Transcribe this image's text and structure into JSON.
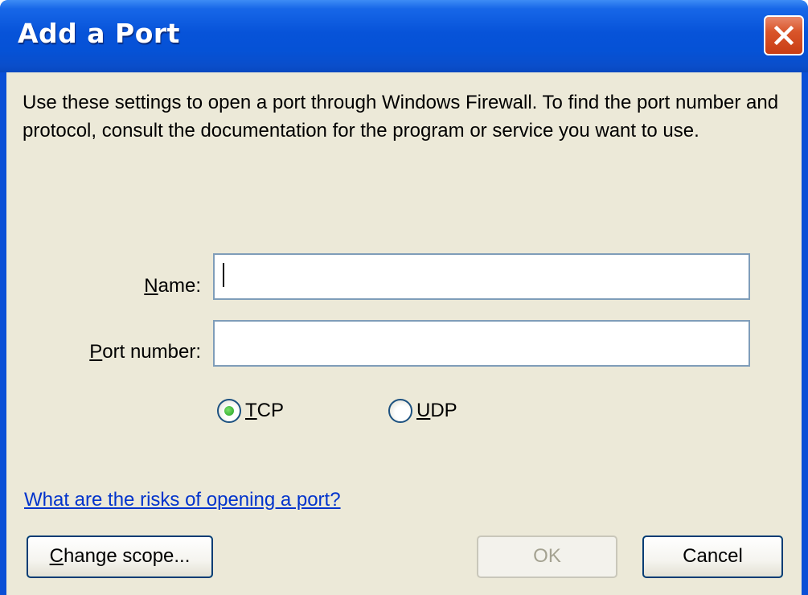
{
  "window": {
    "title": "Add a Port",
    "close_icon": "close-x-icon"
  },
  "dialog": {
    "description": "Use these settings to open a port through Windows Firewall. To find the port number and protocol, consult the documentation for the program or service you want to use.",
    "name_label_accel": "N",
    "name_label_rest": "ame:",
    "name_value": "",
    "port_label_accel": "P",
    "port_label_rest": "ort number:",
    "port_value": "",
    "tcp_label_accel": "T",
    "tcp_label_rest": "CP",
    "tcp_selected": true,
    "udp_label_accel": "U",
    "udp_label_rest": "DP",
    "udp_selected": false,
    "risk_link": "What are the risks of opening a port?",
    "change_scope_accel": "C",
    "change_scope_rest": "hange scope...",
    "ok_label": "OK",
    "ok_enabled": false,
    "cancel_label": "Cancel"
  },
  "colors": {
    "titlebar": "#0552d6",
    "client_bg": "#ece9d8",
    "link": "#0033cc",
    "radio_selected": "#21a121"
  }
}
